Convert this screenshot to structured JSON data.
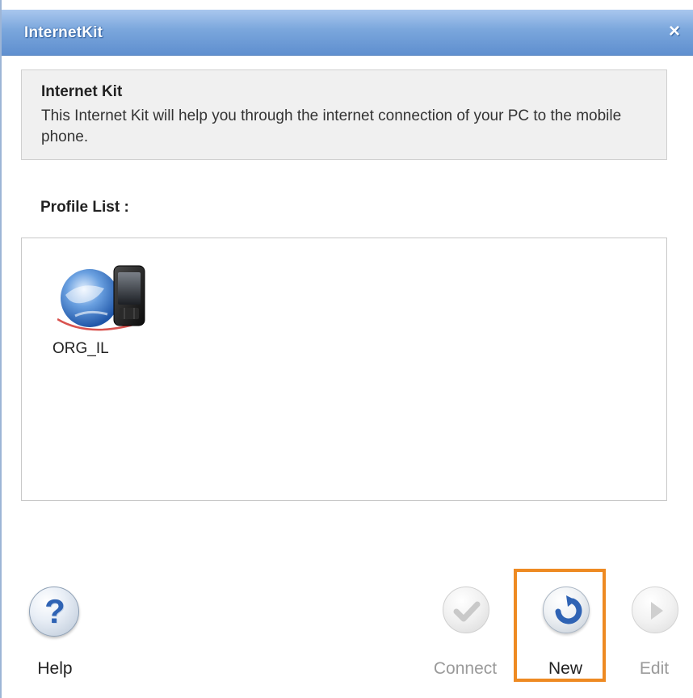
{
  "window": {
    "title": "InternetKit",
    "close_glyph": "×"
  },
  "info": {
    "title": "Internet Kit",
    "description": "This Internet Kit will help you through the internet connection of your PC to the mobile phone."
  },
  "profiles": {
    "label": "Profile List :",
    "items": [
      {
        "name": "ORG_IL",
        "icon": "globe-phone-icon"
      }
    ]
  },
  "buttons": {
    "help": {
      "label": "Help",
      "icon": "question-icon"
    },
    "connect": {
      "label": "Connect",
      "icon": "checkmark-icon",
      "enabled": false
    },
    "new": {
      "label": "New",
      "icon": "refresh-arrow-icon",
      "enabled": true,
      "highlighted": true
    },
    "edit": {
      "label": "Edit",
      "icon": "play-arrow-icon",
      "enabled": false
    }
  },
  "colors": {
    "titlebar": "#7aa6dc",
    "highlight": "#ee8a22",
    "accent_blue": "#2f63b4"
  }
}
